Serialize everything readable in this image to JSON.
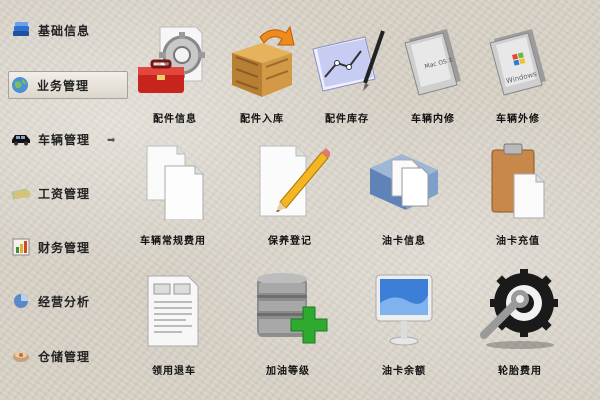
{
  "sidebar": {
    "items": [
      {
        "label": "基础信息",
        "icon": "books-icon"
      },
      {
        "label": "业务管理",
        "icon": "globe-icon"
      },
      {
        "label": "车辆管理",
        "icon": "car-icon"
      },
      {
        "label": "工资管理",
        "icon": "money-icon"
      },
      {
        "label": "财务管理",
        "icon": "finance-chart-icon"
      },
      {
        "label": "经营分析",
        "icon": "analysis-icon"
      },
      {
        "label": "仓储管理",
        "icon": "warehouse-icon"
      }
    ],
    "active_index": 1,
    "arrow_icon": "arrow-right-icon"
  },
  "grid": {
    "row1": [
      {
        "label": "配件信息",
        "icon": "toolbox-gear-icon"
      },
      {
        "label": "配件入库",
        "icon": "box-inbound-icon"
      },
      {
        "label": "配件库存",
        "icon": "stock-pen-icon"
      },
      {
        "label": "车辆内修",
        "icon": "disc-inner-icon"
      },
      {
        "label": "车辆外修",
        "icon": "disc-outer-icon"
      }
    ],
    "row2": [
      {
        "label": "车辆常规费用",
        "icon": "documents-icon"
      },
      {
        "label": "保养登记",
        "icon": "pencil-document-icon"
      },
      {
        "label": "油卡信息",
        "icon": "folder-card-icon"
      },
      {
        "label": "油卡充值",
        "icon": "clipboard-icon"
      }
    ],
    "row3": [
      {
        "label": "领用退车",
        "icon": "form-document-icon"
      },
      {
        "label": "加油等级",
        "icon": "database-add-icon"
      },
      {
        "label": "油卡余额",
        "icon": "monitor-icon"
      },
      {
        "label": "轮胎费用",
        "icon": "wrench-gear-icon"
      }
    ]
  },
  "disc_text": {
    "inner": "Mac OS X",
    "outer": "Windows"
  }
}
